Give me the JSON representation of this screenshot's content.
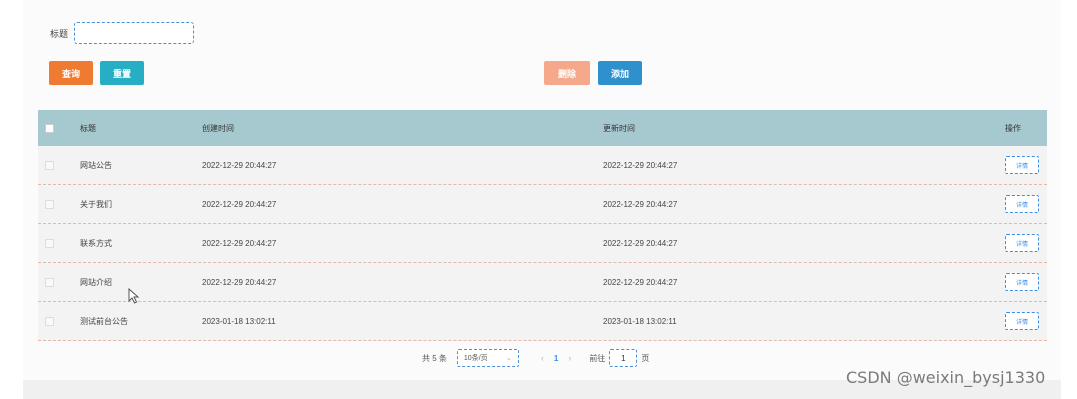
{
  "search": {
    "label": "标题",
    "value": "",
    "placeholder": ""
  },
  "buttons": {
    "query": "查询",
    "reset": "重置",
    "delete": "删除",
    "add": "添加"
  },
  "colors": {
    "query": "#ef7b32",
    "reset": "#27aec4",
    "delete": "#f6a98a",
    "add": "#2e90cc",
    "header_bg": "#a6c9cf",
    "link": "#3a8ee6"
  },
  "table": {
    "headers": {
      "title": "标题",
      "created": "创建时间",
      "updated": "更新时间",
      "operation": "操作"
    },
    "detail_label": "详情",
    "rows": [
      {
        "title": "网站公告",
        "created": "2022-12-29 20:44:27",
        "updated": "2022-12-29 20:44:27"
      },
      {
        "title": "关于我们",
        "created": "2022-12-29 20:44:27",
        "updated": "2022-12-29 20:44:27"
      },
      {
        "title": "联系方式",
        "created": "2022-12-29 20:44:27",
        "updated": "2022-12-29 20:44:27"
      },
      {
        "title": "网站介绍",
        "created": "2022-12-29 20:44:27",
        "updated": "2022-12-29 20:44:27"
      },
      {
        "title": "测试前台公告",
        "created": "2023-01-18 13:02:11",
        "updated": "2023-01-18 13:02:11"
      }
    ]
  },
  "pagination": {
    "total": "共 5 条",
    "page_size": "10条/页",
    "current_page": "1",
    "goto_label": "前往",
    "goto_value": "1",
    "page_suffix": "页",
    "prev_icon": "chevron-left-icon",
    "next_icon": "chevron-right-icon"
  },
  "watermark": "CSDN @weixin_bysj1330"
}
